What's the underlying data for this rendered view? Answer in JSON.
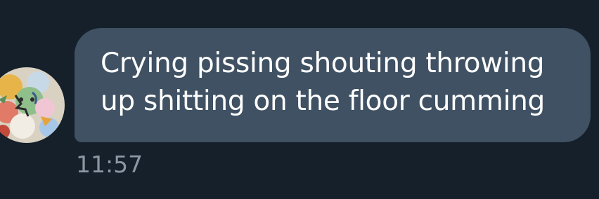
{
  "chat": {
    "message": {
      "text": "Crying pissing shouting throwing up shitting on the floor cumming",
      "timestamp": "11:57"
    },
    "avatar": {
      "icon": "sender-avatar-illustration"
    }
  },
  "colors": {
    "background": "#16202b",
    "bubble": "#3f5163",
    "message_text": "#ffffff",
    "timestamp_text": "#8b97a4"
  }
}
